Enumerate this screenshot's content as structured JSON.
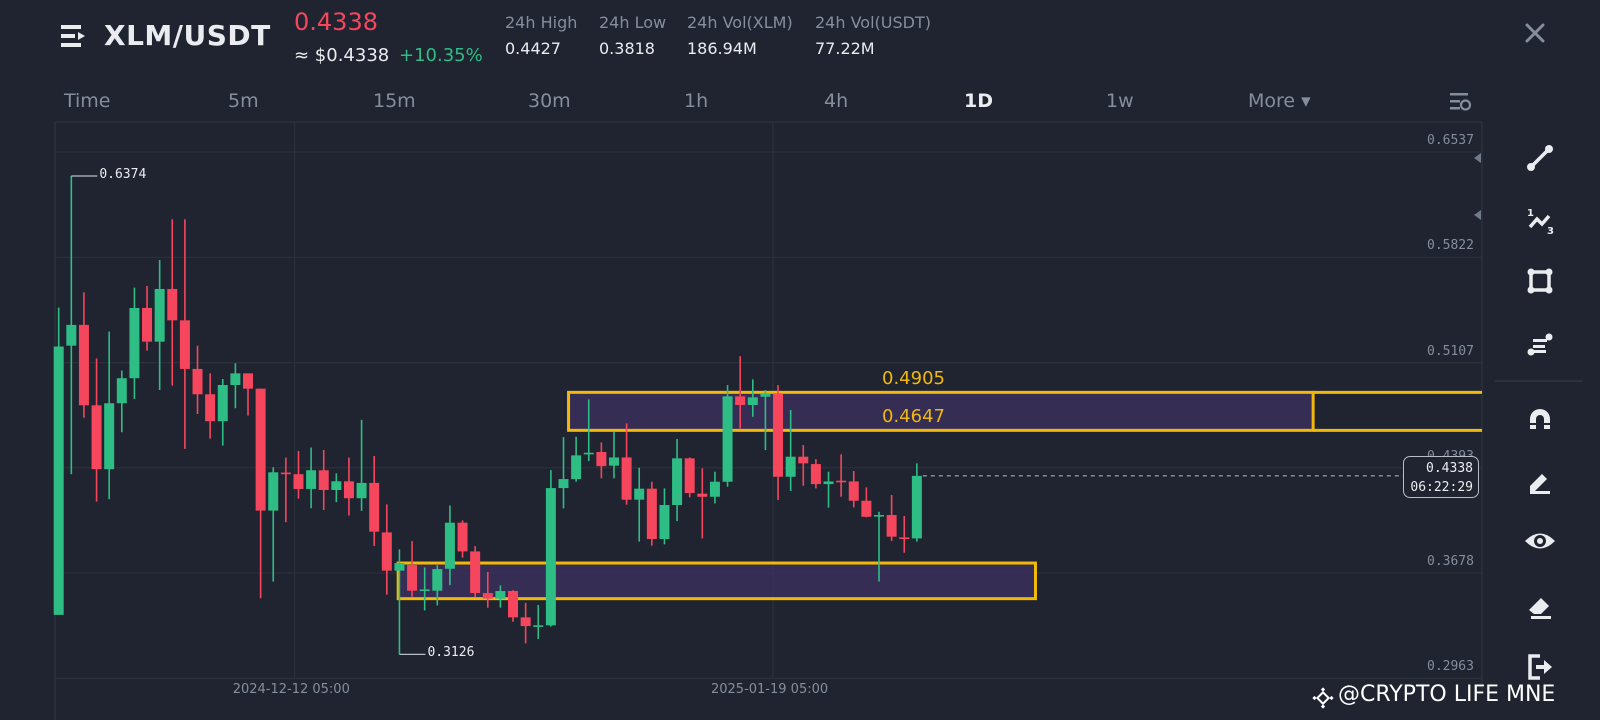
{
  "header": {
    "pair": "XLM/USDT",
    "last_price": "0.4338",
    "usd_price": "≈ $0.4338",
    "change": "+10.35%",
    "stats": [
      {
        "label": "24h High",
        "value": "0.4427"
      },
      {
        "label": "24h Low",
        "value": "0.3818"
      },
      {
        "label": "24h Vol(XLM)",
        "value": "186.94M"
      },
      {
        "label": "24h Vol(USDT)",
        "value": "77.22M"
      }
    ]
  },
  "timeframes": [
    {
      "label": "Time"
    },
    {
      "label": "5m"
    },
    {
      "label": "15m"
    },
    {
      "label": "30m"
    },
    {
      "label": "1h"
    },
    {
      "label": "4h"
    },
    {
      "label": "1D",
      "active": true
    },
    {
      "label": "1w"
    },
    {
      "label": "More ▾"
    }
  ],
  "colors": {
    "up": "#2ebd85",
    "down": "#f6465d",
    "zone": "#f0b90b",
    "zone_fill": "#3b2f5c",
    "grid": "#2b3139",
    "bg": "#1f2430"
  },
  "watermark": "@CRYPTO LIFE MNE",
  "chart_data": {
    "type": "candlestick",
    "symbol": "XLM/USDT",
    "interval": "1D",
    "candle_format": [
      "open",
      "high",
      "low",
      "close"
    ],
    "candles": [
      [
        0.3394,
        0.548,
        0.3394,
        0.5216
      ],
      [
        0.5222,
        0.6374,
        0.4349,
        0.5363
      ],
      [
        0.5363,
        0.5584,
        0.4733,
        0.4817
      ],
      [
        0.4817,
        0.5136,
        0.4163,
        0.4383
      ],
      [
        0.4383,
        0.5317,
        0.4179,
        0.4831
      ],
      [
        0.4831,
        0.5053,
        0.4634,
        0.5001
      ],
      [
        0.5001,
        0.5616,
        0.486,
        0.5478
      ],
      [
        0.5478,
        0.5627,
        0.5188,
        0.5249
      ],
      [
        0.5249,
        0.5804,
        0.4921,
        0.5607
      ],
      [
        0.5607,
        0.608,
        0.4951,
        0.5394
      ],
      [
        0.5394,
        0.608,
        0.4521,
        0.5064
      ],
      [
        0.5064,
        0.5222,
        0.4758,
        0.4892
      ],
      [
        0.4892,
        0.5034,
        0.4591,
        0.4709
      ],
      [
        0.4709,
        0.4996,
        0.4543,
        0.4955
      ],
      [
        0.4955,
        0.5102,
        0.4797,
        0.5034
      ],
      [
        0.5034,
        0.5034,
        0.4747,
        0.493
      ],
      [
        0.493,
        0.493,
        0.3507,
        0.4102
      ],
      [
        0.4102,
        0.4396,
        0.362,
        0.4362
      ],
      [
        0.436,
        0.4462,
        0.4023,
        0.4351
      ],
      [
        0.4349,
        0.4507,
        0.4183,
        0.4249
      ],
      [
        0.4249,
        0.453,
        0.4118,
        0.4376
      ],
      [
        0.4376,
        0.4514,
        0.4106,
        0.4242
      ],
      [
        0.4242,
        0.4355,
        0.4159,
        0.4301
      ],
      [
        0.4301,
        0.4462,
        0.4068,
        0.4186
      ],
      [
        0.4186,
        0.4718,
        0.41,
        0.429
      ],
      [
        0.429,
        0.4473,
        0.3862,
        0.3959
      ],
      [
        0.3954,
        0.4144,
        0.3531,
        0.3694
      ],
      [
        0.3694,
        0.3839,
        0.3126,
        0.3746
      ],
      [
        0.3732,
        0.3895,
        0.3517,
        0.3558
      ],
      [
        0.3558,
        0.3716,
        0.3424,
        0.3567
      ],
      [
        0.3558,
        0.3732,
        0.3458,
        0.3705
      ],
      [
        0.3707,
        0.4137,
        0.3596,
        0.402
      ],
      [
        0.402,
        0.4036,
        0.3782,
        0.3825
      ],
      [
        0.3825,
        0.3861,
        0.3513,
        0.3542
      ],
      [
        0.3542,
        0.3685,
        0.3443,
        0.3504
      ],
      [
        0.3504,
        0.3594,
        0.3443,
        0.3556
      ],
      [
        0.3556,
        0.3562,
        0.3347,
        0.3377
      ],
      [
        0.3377,
        0.3476,
        0.32,
        0.3318
      ],
      [
        0.3318,
        0.3461,
        0.323,
        0.3323
      ],
      [
        0.3323,
        0.4377,
        0.3314,
        0.4255
      ],
      [
        0.4255,
        0.4601,
        0.4117,
        0.4316
      ],
      [
        0.4316,
        0.4604,
        0.4298,
        0.4477
      ],
      [
        0.4484,
        0.4857,
        0.4438,
        0.4495
      ],
      [
        0.45,
        0.4565,
        0.4321,
        0.4404
      ],
      [
        0.4407,
        0.4638,
        0.4321,
        0.4463
      ],
      [
        0.4463,
        0.4694,
        0.4142,
        0.4176
      ],
      [
        0.4176,
        0.4393,
        0.3891,
        0.4251
      ],
      [
        0.4251,
        0.4298,
        0.3864,
        0.3909
      ],
      [
        0.3909,
        0.4253,
        0.3873,
        0.414
      ],
      [
        0.414,
        0.4588,
        0.4031,
        0.4457
      ],
      [
        0.4457,
        0.4463,
        0.4192,
        0.4221
      ],
      [
        0.4217,
        0.4389,
        0.3913,
        0.4196
      ],
      [
        0.4196,
        0.4366,
        0.4151,
        0.4298
      ],
      [
        0.4298,
        0.4954,
        0.4264,
        0.4878
      ],
      [
        0.4878,
        0.5151,
        0.466,
        0.4819
      ],
      [
        0.4819,
        0.4993,
        0.4739,
        0.4871
      ],
      [
        0.4875,
        0.492,
        0.4513,
        0.4898
      ],
      [
        0.4898,
        0.4954,
        0.4174,
        0.4332
      ],
      [
        0.4332,
        0.4785,
        0.4235,
        0.4468
      ],
      [
        0.4468,
        0.4547,
        0.4271,
        0.4423
      ],
      [
        0.4418,
        0.4452,
        0.4253,
        0.4282
      ],
      [
        0.4282,
        0.4366,
        0.4122,
        0.43
      ],
      [
        0.4305,
        0.4484,
        0.4196,
        0.4298
      ],
      [
        0.43,
        0.4371,
        0.4124,
        0.4169
      ],
      [
        0.4169,
        0.426,
        0.4056,
        0.406
      ],
      [
        0.4065,
        0.4094,
        0.362,
        0.4072
      ],
      [
        0.4072,
        0.4208,
        0.3895,
        0.3925
      ],
      [
        0.392,
        0.4065,
        0.3816,
        0.3913
      ],
      [
        0.3913,
        0.4423,
        0.3891,
        0.4338
      ]
    ],
    "y_ticks": [
      "0.6537",
      "0.5822",
      "0.5107",
      "0.4393",
      "0.3678",
      "0.2963"
    ],
    "ylim": [
      0.2963,
      0.6537
    ],
    "x_ticks": [
      {
        "label": "2024-12-12 05:00",
        "index": 18.7
      },
      {
        "label": "2025-01-19 05:00",
        "index": 56.6
      }
    ],
    "high_marker": {
      "label": "0.6374",
      "index": 1,
      "value": 0.6374
    },
    "low_marker": {
      "label": "0.3126",
      "index": 27,
      "value": 0.3126
    },
    "current": {
      "price": "0.4338",
      "value": 0.4338,
      "countdown": "06:22:29"
    },
    "zones": [
      {
        "name": "resistance",
        "top": 0.4905,
        "bottom": 0.4647,
        "top_label": "0.4905",
        "bottom_label": "0.4647",
        "start_index": 40.4,
        "end_index": 99.4,
        "extends_right": true
      },
      {
        "name": "support",
        "top": 0.3746,
        "bottom": 0.3504,
        "start_index": 26.9,
        "end_index": 77.4
      }
    ],
    "grid": true
  }
}
